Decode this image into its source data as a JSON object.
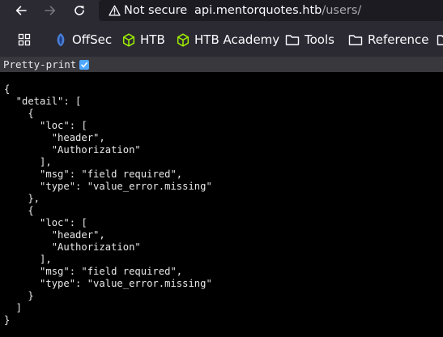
{
  "toolbar": {
    "security_label": "Not secure",
    "url_domain": "api.mentorquotes.htb",
    "url_path": "/users/"
  },
  "bookmarks": {
    "items": [
      {
        "label": "OffSec",
        "icon": "offsec-icon"
      },
      {
        "label": "HTB",
        "icon": "htb-cube-icon"
      },
      {
        "label": "HTB Academy",
        "icon": "htb-cube-icon"
      },
      {
        "label": "Tools",
        "icon": "folder-icon"
      },
      {
        "label": "Reference",
        "icon": "folder-icon"
      }
    ]
  },
  "viewer": {
    "pretty_print_label": "Pretty-print",
    "pretty_print_checked": true
  },
  "json_text": "{\n  \"detail\": [\n    {\n      \"loc\": [\n        \"header\",\n        \"Authorization\"\n      ],\n      \"msg\": \"field required\",\n      \"type\": \"value_error.missing\"\n    },\n    {\n      \"loc\": [\n        \"header\",\n        \"Authorization\"\n      ],\n      \"msg\": \"field required\",\n      \"type\": \"value_error.missing\"\n    }\n  ]\n}",
  "colors": {
    "toolbar_bg": "#2b2a33",
    "urlbar_bg": "#1c1b22",
    "pretty_print_bar": "#38383d",
    "htb_green": "#9fef00",
    "checkbox_blue": "#4fa8ff"
  }
}
